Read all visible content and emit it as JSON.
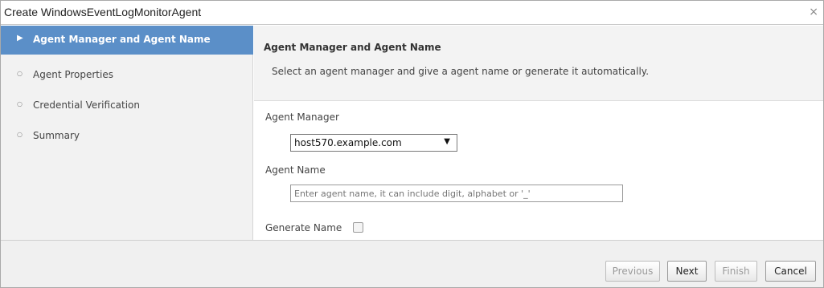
{
  "dialog": {
    "title": "Create WindowsEventLogMonitorAgent",
    "close_symbol": "×"
  },
  "sidebar": {
    "steps": [
      {
        "label": "Agent Manager and Agent Name",
        "active": true,
        "marker": "▶"
      },
      {
        "label": "Agent Properties",
        "active": false,
        "marker": "○"
      },
      {
        "label": "Credential Verification",
        "active": false,
        "marker": "○"
      },
      {
        "label": "Summary",
        "active": false,
        "marker": "○"
      }
    ]
  },
  "main": {
    "title": "Agent Manager and Agent Name",
    "description": "Select an agent manager and give a agent name or generate it automatically.",
    "agent_manager_label": "Agent Manager",
    "agent_manager_value": "host570.example.com",
    "agent_name_label": "Agent Name",
    "agent_name_placeholder": "Enter agent name, it can include digit, alphabet or '_'",
    "generate_name_label": "Generate Name"
  },
  "footer": {
    "previous": "Previous",
    "next": "Next",
    "finish": "Finish",
    "cancel": "Cancel"
  },
  "colors": {
    "active_step": "#5b8fc8",
    "sidebar_bg": "#f2f2f2"
  }
}
